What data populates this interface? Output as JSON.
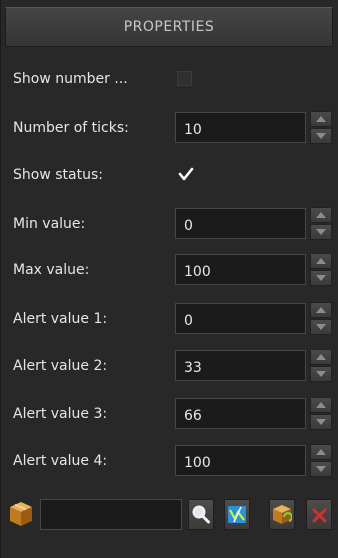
{
  "panel": {
    "title": "PROPERTIES"
  },
  "rows": [
    {
      "label": "Show number ...",
      "type": "checkbox",
      "checked": false
    },
    {
      "label": "Number of ticks:",
      "type": "number",
      "value": "10"
    },
    {
      "label": "Show status:",
      "type": "checkbox",
      "checked": true
    },
    {
      "label": "Min value:",
      "type": "number",
      "value": "0"
    },
    {
      "label": "Max value:",
      "type": "number",
      "value": "100"
    },
    {
      "label": "Alert value 1:",
      "type": "number",
      "value": "0"
    },
    {
      "label": "Alert value 2:",
      "type": "number",
      "value": "33"
    },
    {
      "label": "Alert value 3:",
      "type": "number",
      "value": "66"
    },
    {
      "label": "Alert value 4:",
      "type": "number",
      "value": "100"
    }
  ],
  "toolbar": {
    "field_value": "",
    "icons": [
      "package-icon",
      "search-icon",
      "edit-chart-icon",
      "package-refresh-icon",
      "delete-icon"
    ]
  },
  "colors": {
    "panel_bg": "#282828",
    "field_bg": "#1b1b1b",
    "text": "#e6e6e6",
    "header_text": "#c7c7c7"
  }
}
